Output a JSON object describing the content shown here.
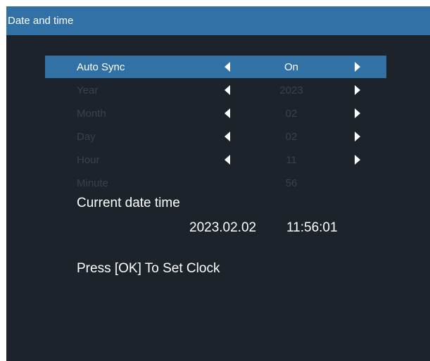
{
  "window": {
    "title": "Date and time"
  },
  "settings": [
    {
      "label": "Auto Sync",
      "value": "On"
    },
    {
      "label": "Year",
      "value": "2023"
    },
    {
      "label": "Month",
      "value": "02"
    },
    {
      "label": "Day",
      "value": "02"
    },
    {
      "label": "Hour",
      "value": "11"
    },
    {
      "label": "Minute",
      "value": "56"
    }
  ],
  "current": {
    "label": "Current date time",
    "date": "2023.02.02",
    "time": "11:56:01"
  },
  "hint": "Press [OK] To Set Clock",
  "colors": {
    "panel": "#1c232b",
    "accent": "#3271a6",
    "text": "#ffffff",
    "disabled": "#3a4149"
  },
  "icons": {
    "decrease": "triangle-left-icon",
    "increase": "triangle-right-icon"
  }
}
